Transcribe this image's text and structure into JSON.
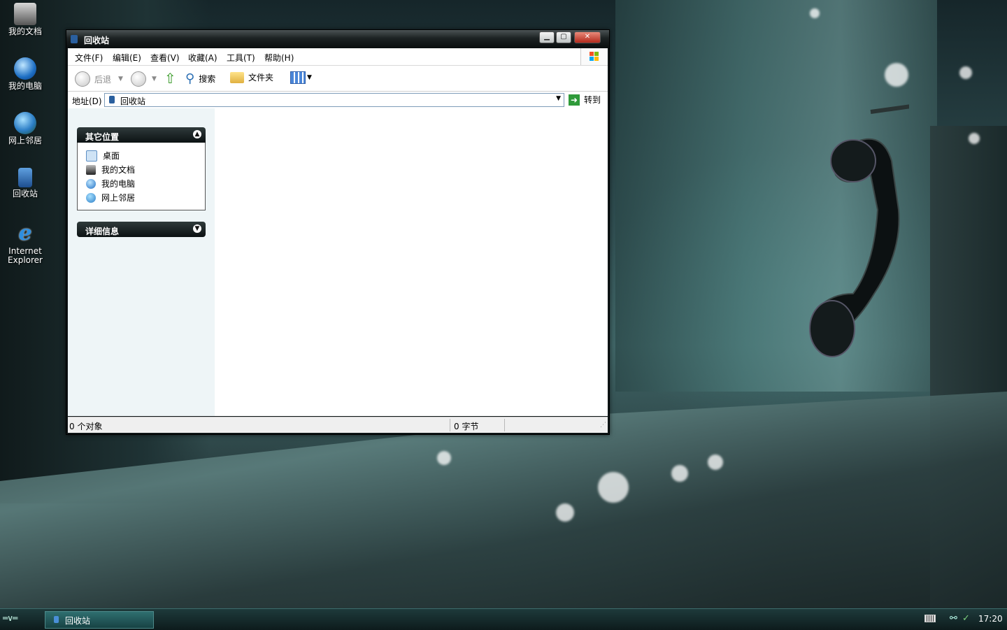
{
  "desktop": {
    "icons": [
      {
        "label": "我的文档",
        "icon": "my-documents-icon"
      },
      {
        "label": "我的电脑",
        "icon": "my-computer-icon"
      },
      {
        "label": "网上邻居",
        "icon": "network-places-icon"
      },
      {
        "label": "回收站",
        "icon": "recycle-bin-icon"
      },
      {
        "label": "Internet Explorer",
        "icon": "internet-explorer-icon"
      }
    ]
  },
  "window": {
    "title": "回收站",
    "menu": [
      "文件(F)",
      "编辑(E)",
      "查看(V)",
      "收藏(A)",
      "工具(T)",
      "帮助(H)"
    ],
    "toolbar": {
      "back": "后退",
      "search": "搜索",
      "folders": "文件夹"
    },
    "address": {
      "label": "地址(D)",
      "value": "回收站",
      "go": "转到"
    },
    "task_pane": {
      "other_places": {
        "title": "其它位置",
        "links": [
          "桌面",
          "我的文档",
          "我的电脑",
          "网上邻居"
        ]
      },
      "details": {
        "title": "详细信息"
      }
    },
    "status": {
      "objects": "0 个对象",
      "size": "0 字节"
    }
  },
  "taskbar": {
    "active_task": "回收站",
    "clock": "17:20"
  },
  "colors": {
    "window_frame": "#0e1516",
    "title_text": "#ffffff",
    "task_pane_bg": "#eef5f7",
    "taskbar_bg": "#173233"
  }
}
